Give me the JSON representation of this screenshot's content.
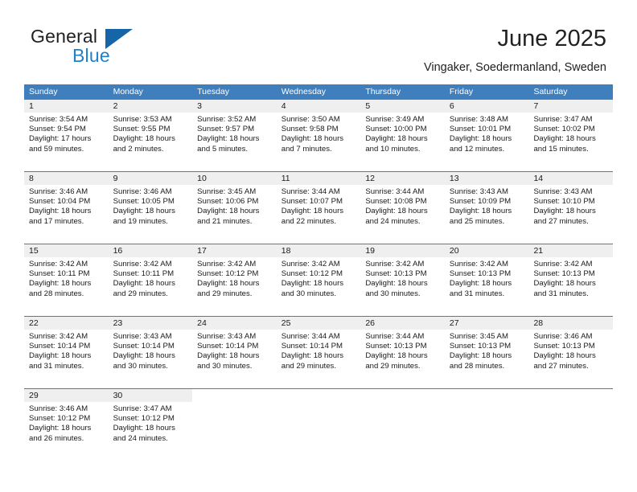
{
  "brand": {
    "name_top": "General",
    "name_bottom": "Blue",
    "triangle_color": "#1565a8",
    "blue_color": "#2081c9"
  },
  "header": {
    "title": "June 2025",
    "subtitle": "Vingaker, Soedermanland, Sweden"
  },
  "theme": {
    "header_blue": "#3f7fbe",
    "daynum_band": "#efefef",
    "text": "#1a1a1a"
  },
  "weekdays": [
    "Sunday",
    "Monday",
    "Tuesday",
    "Wednesday",
    "Thursday",
    "Friday",
    "Saturday"
  ],
  "weeks": [
    {
      "days": [
        {
          "num": "1",
          "sunrise": "Sunrise: 3:54 AM",
          "sunset": "Sunset: 9:54 PM",
          "daylight1": "Daylight: 17 hours",
          "daylight2": "and 59 minutes."
        },
        {
          "num": "2",
          "sunrise": "Sunrise: 3:53 AM",
          "sunset": "Sunset: 9:55 PM",
          "daylight1": "Daylight: 18 hours",
          "daylight2": "and 2 minutes."
        },
        {
          "num": "3",
          "sunrise": "Sunrise: 3:52 AM",
          "sunset": "Sunset: 9:57 PM",
          "daylight1": "Daylight: 18 hours",
          "daylight2": "and 5 minutes."
        },
        {
          "num": "4",
          "sunrise": "Sunrise: 3:50 AM",
          "sunset": "Sunset: 9:58 PM",
          "daylight1": "Daylight: 18 hours",
          "daylight2": "and 7 minutes."
        },
        {
          "num": "5",
          "sunrise": "Sunrise: 3:49 AM",
          "sunset": "Sunset: 10:00 PM",
          "daylight1": "Daylight: 18 hours",
          "daylight2": "and 10 minutes."
        },
        {
          "num": "6",
          "sunrise": "Sunrise: 3:48 AM",
          "sunset": "Sunset: 10:01 PM",
          "daylight1": "Daylight: 18 hours",
          "daylight2": "and 12 minutes."
        },
        {
          "num": "7",
          "sunrise": "Sunrise: 3:47 AM",
          "sunset": "Sunset: 10:02 PM",
          "daylight1": "Daylight: 18 hours",
          "daylight2": "and 15 minutes."
        }
      ]
    },
    {
      "days": [
        {
          "num": "8",
          "sunrise": "Sunrise: 3:46 AM",
          "sunset": "Sunset: 10:04 PM",
          "daylight1": "Daylight: 18 hours",
          "daylight2": "and 17 minutes."
        },
        {
          "num": "9",
          "sunrise": "Sunrise: 3:46 AM",
          "sunset": "Sunset: 10:05 PM",
          "daylight1": "Daylight: 18 hours",
          "daylight2": "and 19 minutes."
        },
        {
          "num": "10",
          "sunrise": "Sunrise: 3:45 AM",
          "sunset": "Sunset: 10:06 PM",
          "daylight1": "Daylight: 18 hours",
          "daylight2": "and 21 minutes."
        },
        {
          "num": "11",
          "sunrise": "Sunrise: 3:44 AM",
          "sunset": "Sunset: 10:07 PM",
          "daylight1": "Daylight: 18 hours",
          "daylight2": "and 22 minutes."
        },
        {
          "num": "12",
          "sunrise": "Sunrise: 3:44 AM",
          "sunset": "Sunset: 10:08 PM",
          "daylight1": "Daylight: 18 hours",
          "daylight2": "and 24 minutes."
        },
        {
          "num": "13",
          "sunrise": "Sunrise: 3:43 AM",
          "sunset": "Sunset: 10:09 PM",
          "daylight1": "Daylight: 18 hours",
          "daylight2": "and 25 minutes."
        },
        {
          "num": "14",
          "sunrise": "Sunrise: 3:43 AM",
          "sunset": "Sunset: 10:10 PM",
          "daylight1": "Daylight: 18 hours",
          "daylight2": "and 27 minutes."
        }
      ]
    },
    {
      "days": [
        {
          "num": "15",
          "sunrise": "Sunrise: 3:42 AM",
          "sunset": "Sunset: 10:11 PM",
          "daylight1": "Daylight: 18 hours",
          "daylight2": "and 28 minutes."
        },
        {
          "num": "16",
          "sunrise": "Sunrise: 3:42 AM",
          "sunset": "Sunset: 10:11 PM",
          "daylight1": "Daylight: 18 hours",
          "daylight2": "and 29 minutes."
        },
        {
          "num": "17",
          "sunrise": "Sunrise: 3:42 AM",
          "sunset": "Sunset: 10:12 PM",
          "daylight1": "Daylight: 18 hours",
          "daylight2": "and 29 minutes."
        },
        {
          "num": "18",
          "sunrise": "Sunrise: 3:42 AM",
          "sunset": "Sunset: 10:12 PM",
          "daylight1": "Daylight: 18 hours",
          "daylight2": "and 30 minutes."
        },
        {
          "num": "19",
          "sunrise": "Sunrise: 3:42 AM",
          "sunset": "Sunset: 10:13 PM",
          "daylight1": "Daylight: 18 hours",
          "daylight2": "and 30 minutes."
        },
        {
          "num": "20",
          "sunrise": "Sunrise: 3:42 AM",
          "sunset": "Sunset: 10:13 PM",
          "daylight1": "Daylight: 18 hours",
          "daylight2": "and 31 minutes."
        },
        {
          "num": "21",
          "sunrise": "Sunrise: 3:42 AM",
          "sunset": "Sunset: 10:13 PM",
          "daylight1": "Daylight: 18 hours",
          "daylight2": "and 31 minutes."
        }
      ]
    },
    {
      "days": [
        {
          "num": "22",
          "sunrise": "Sunrise: 3:42 AM",
          "sunset": "Sunset: 10:14 PM",
          "daylight1": "Daylight: 18 hours",
          "daylight2": "and 31 minutes."
        },
        {
          "num": "23",
          "sunrise": "Sunrise: 3:43 AM",
          "sunset": "Sunset: 10:14 PM",
          "daylight1": "Daylight: 18 hours",
          "daylight2": "and 30 minutes."
        },
        {
          "num": "24",
          "sunrise": "Sunrise: 3:43 AM",
          "sunset": "Sunset: 10:14 PM",
          "daylight1": "Daylight: 18 hours",
          "daylight2": "and 30 minutes."
        },
        {
          "num": "25",
          "sunrise": "Sunrise: 3:44 AM",
          "sunset": "Sunset: 10:14 PM",
          "daylight1": "Daylight: 18 hours",
          "daylight2": "and 29 minutes."
        },
        {
          "num": "26",
          "sunrise": "Sunrise: 3:44 AM",
          "sunset": "Sunset: 10:13 PM",
          "daylight1": "Daylight: 18 hours",
          "daylight2": "and 29 minutes."
        },
        {
          "num": "27",
          "sunrise": "Sunrise: 3:45 AM",
          "sunset": "Sunset: 10:13 PM",
          "daylight1": "Daylight: 18 hours",
          "daylight2": "and 28 minutes."
        },
        {
          "num": "28",
          "sunrise": "Sunrise: 3:46 AM",
          "sunset": "Sunset: 10:13 PM",
          "daylight1": "Daylight: 18 hours",
          "daylight2": "and 27 minutes."
        }
      ]
    },
    {
      "days": [
        {
          "num": "29",
          "sunrise": "Sunrise: 3:46 AM",
          "sunset": "Sunset: 10:12 PM",
          "daylight1": "Daylight: 18 hours",
          "daylight2": "and 26 minutes."
        },
        {
          "num": "30",
          "sunrise": "Sunrise: 3:47 AM",
          "sunset": "Sunset: 10:12 PM",
          "daylight1": "Daylight: 18 hours",
          "daylight2": "and 24 minutes."
        },
        {
          "num": "",
          "sunrise": "",
          "sunset": "",
          "daylight1": "",
          "daylight2": ""
        },
        {
          "num": "",
          "sunrise": "",
          "sunset": "",
          "daylight1": "",
          "daylight2": ""
        },
        {
          "num": "",
          "sunrise": "",
          "sunset": "",
          "daylight1": "",
          "daylight2": ""
        },
        {
          "num": "",
          "sunrise": "",
          "sunset": "",
          "daylight1": "",
          "daylight2": ""
        },
        {
          "num": "",
          "sunrise": "",
          "sunset": "",
          "daylight1": "",
          "daylight2": ""
        }
      ]
    }
  ]
}
